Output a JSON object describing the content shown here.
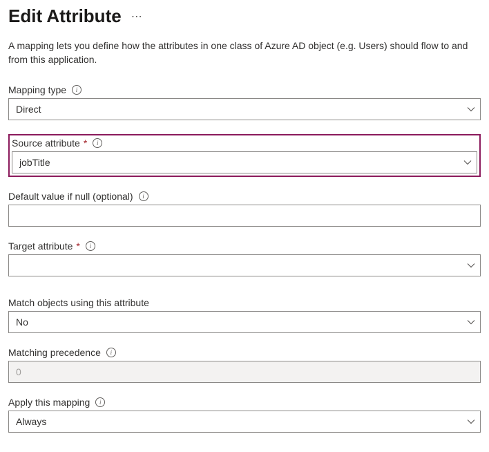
{
  "header": {
    "title": "Edit Attribute"
  },
  "description": "A mapping lets you define how the attributes in one class of Azure AD object (e.g. Users) should flow to and from this application.",
  "fields": {
    "mappingType": {
      "label": "Mapping type",
      "value": "Direct",
      "required": false
    },
    "sourceAttribute": {
      "label": "Source attribute",
      "value": "jobTitle",
      "required": true
    },
    "defaultValue": {
      "label": "Default value if null (optional)",
      "value": "",
      "required": false
    },
    "targetAttribute": {
      "label": "Target attribute",
      "value": "",
      "required": true
    },
    "matchObjects": {
      "label": "Match objects using this attribute",
      "value": "No",
      "required": false
    },
    "matchingPrecedence": {
      "label": "Matching precedence",
      "value": "0",
      "required": false
    },
    "applyMapping": {
      "label": "Apply this mapping",
      "value": "Always",
      "required": false
    }
  }
}
